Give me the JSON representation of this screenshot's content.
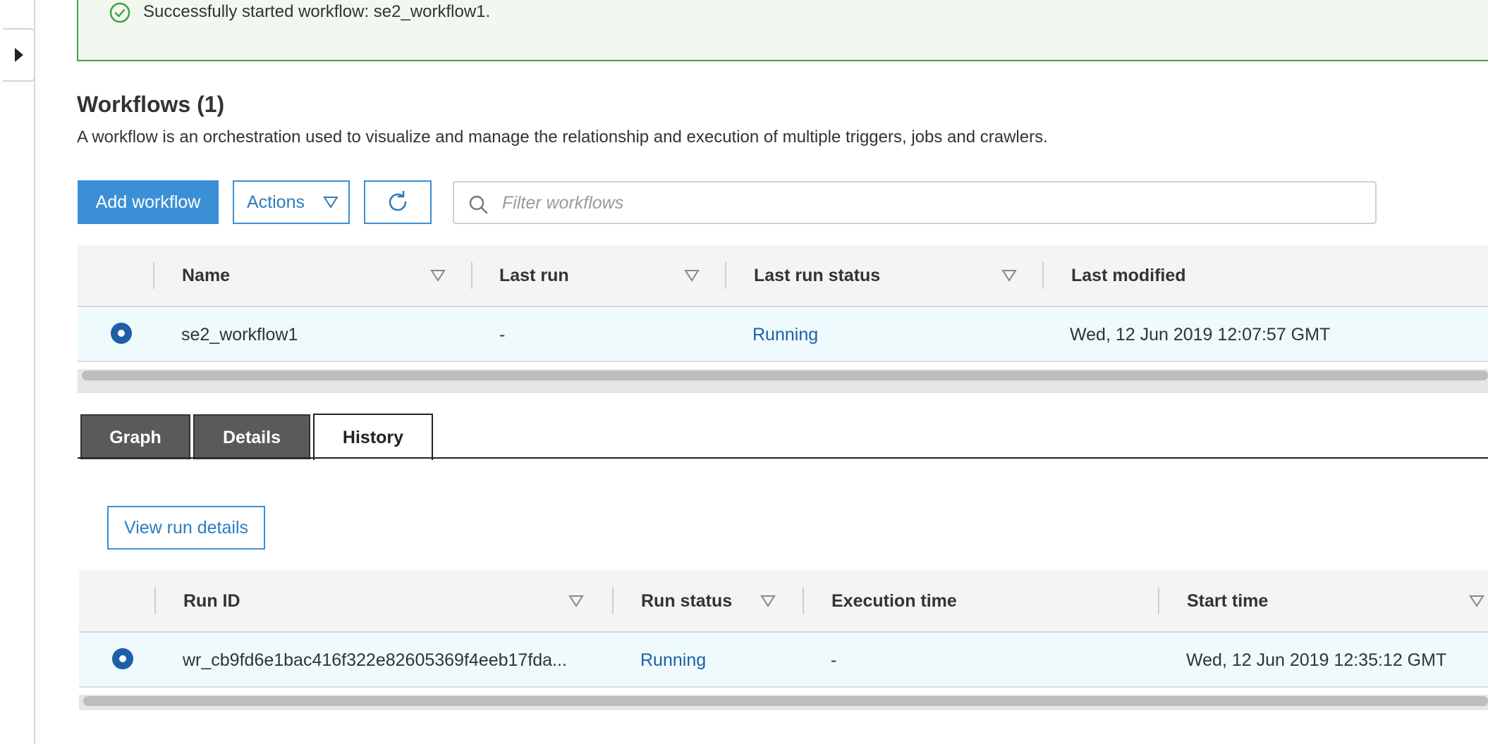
{
  "banner": {
    "message": "Successfully started workflow: se2_workflow1.",
    "icon": "check-circle-icon",
    "color": "#43a047"
  },
  "header": {
    "title": "Workflows (1)",
    "description": "A workflow is an orchestration used to visualize and manage the relationship and execution of multiple triggers, jobs and crawlers."
  },
  "toolbar": {
    "add_label": "Add workflow",
    "actions_label": "Actions",
    "refresh_icon": "refresh-icon",
    "filter_placeholder": "Filter workflows"
  },
  "workflows_table": {
    "columns": [
      "Name",
      "Last run",
      "Last run status",
      "Last modified"
    ],
    "rows": [
      {
        "selected": true,
        "name": "se2_workflow1",
        "last_run": "-",
        "last_run_status": "Running",
        "last_modified": "Wed, 12 Jun 2019 12:07:57 GMT"
      }
    ]
  },
  "tabs": [
    {
      "label": "Graph",
      "active": false
    },
    {
      "label": "Details",
      "active": false
    },
    {
      "label": "History",
      "active": true
    }
  ],
  "history": {
    "view_button": "View run details",
    "columns": [
      "Run ID",
      "Run status",
      "Execution time",
      "Start time"
    ],
    "rows": [
      {
        "selected": true,
        "run_id": "wr_cb9fd6e1bac416f322e82605369f4eeb17fda...",
        "run_status": "Running",
        "execution_time": "-",
        "start_time": "Wed, 12 Jun 2019 12:35:12 GMT"
      }
    ]
  },
  "colors": {
    "primary": "#3b8fd6",
    "link": "#1f5fa8",
    "success": "#43a047",
    "row_selected_bg": "#effafc",
    "tab_dark": "#5a5a5a"
  }
}
